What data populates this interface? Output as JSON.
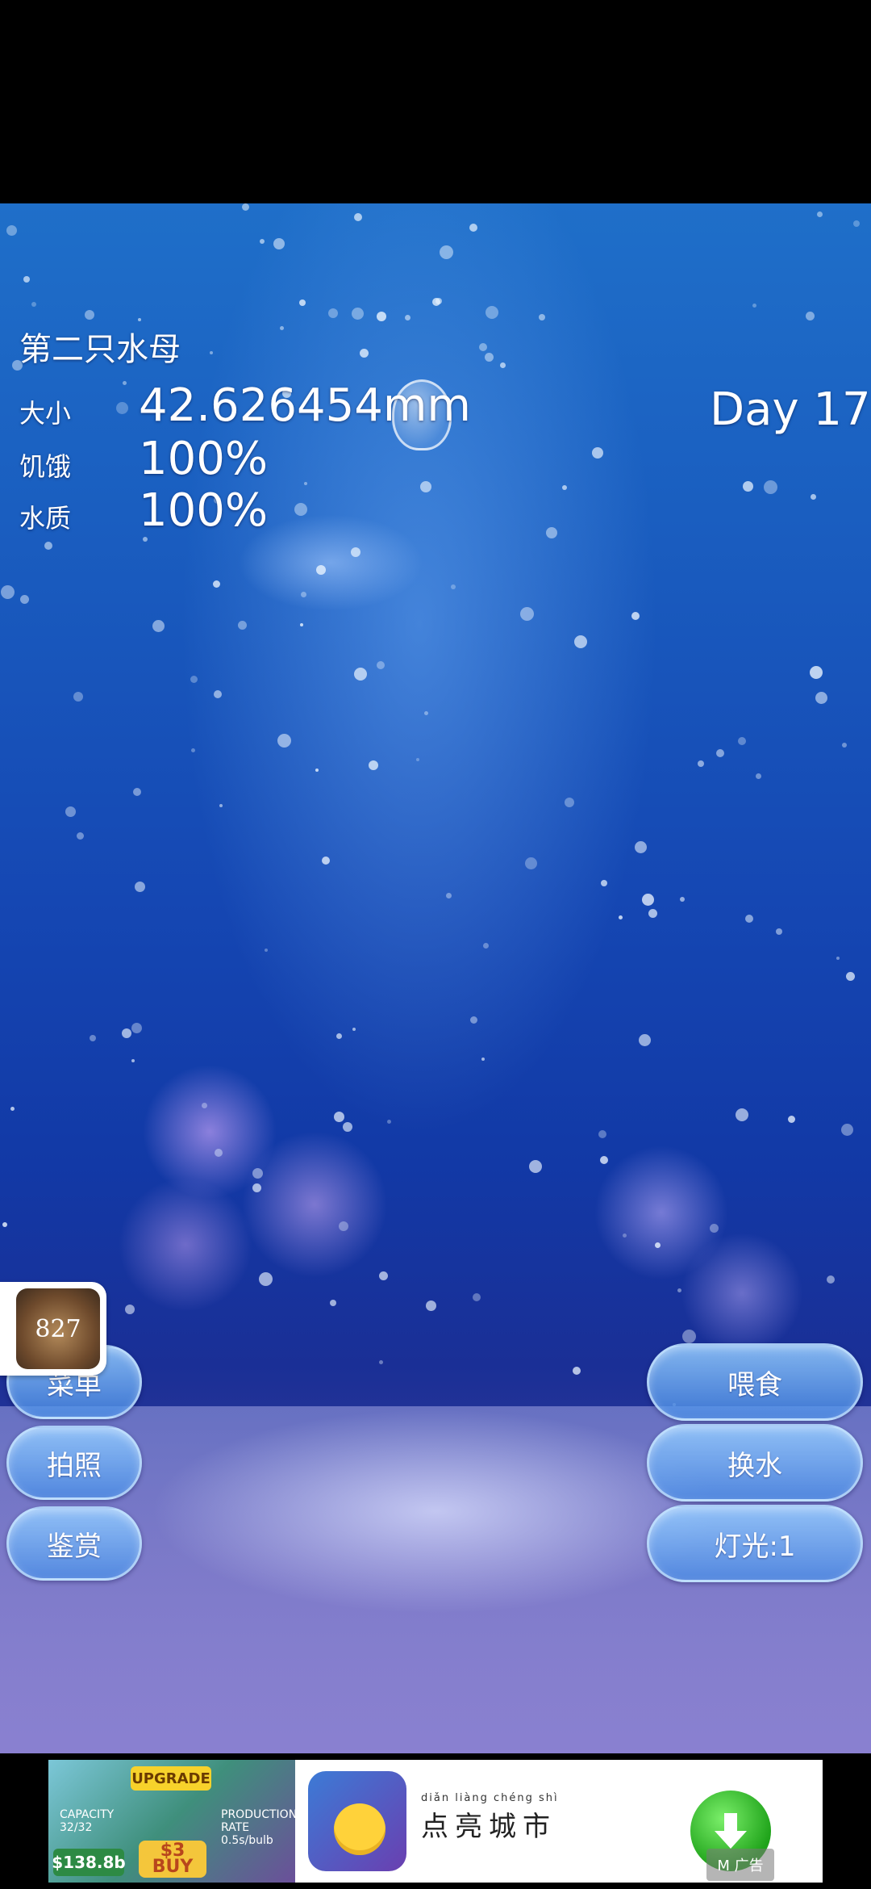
{
  "tank": {
    "name": "第二只水母",
    "day": "Day 17",
    "stats": [
      {
        "label": "大小",
        "value": "42.626454mm"
      },
      {
        "label": "饥饿",
        "value": "100%"
      },
      {
        "label": "水质",
        "value": "100%"
      }
    ]
  },
  "left_buttons": [
    "菜单",
    "拍照",
    "鉴赏"
  ],
  "right_buttons": [
    "喂食",
    "换水",
    "灯光:1"
  ],
  "avatar": {
    "text": "827"
  },
  "ad": {
    "game_upgrade": "UPGRADE",
    "game_capacity": "CAPACITY 32/32",
    "game_money": "$138.8b",
    "game_buy_price": "$3",
    "game_buy": "BUY",
    "game_production": "PRODUCTION RATE 0.5s/bulb",
    "pinyin": "diǎn liàng chéng shì",
    "title": "点亮城市",
    "badge": "M 广告"
  },
  "colors": {
    "water_top": "#1f6fc9",
    "water_deep": "#1239a6",
    "button_fill": "#78b8f5",
    "download_green": "#1fa31a"
  },
  "icons": {
    "download": "download-arrow-icon",
    "jellyfish": "jellyfish-sprite",
    "avatar": "avatar-icon"
  }
}
